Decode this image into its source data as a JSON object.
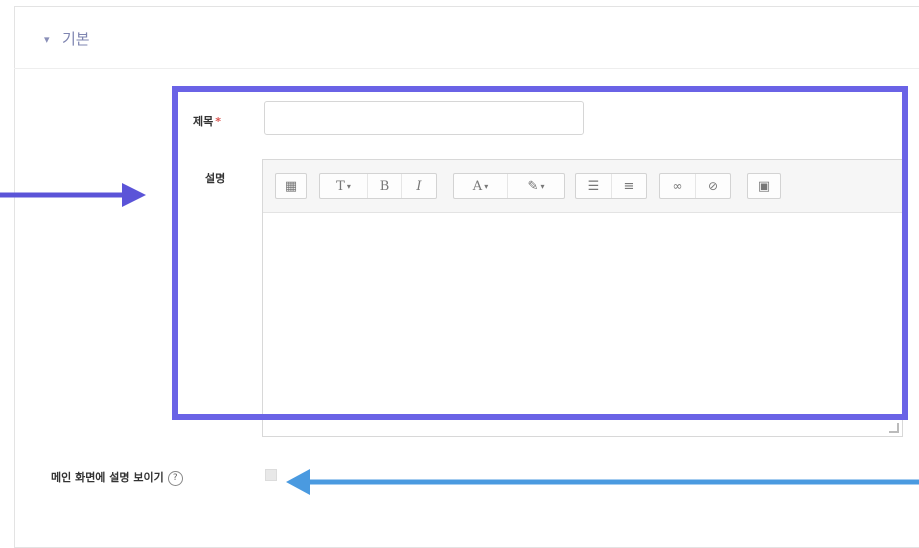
{
  "section": {
    "toggle_icon": "caret-down-icon",
    "title": "기본"
  },
  "form": {
    "title_label": "제목",
    "required_mark": "*",
    "title_value": "",
    "description_label": "설명",
    "editor_toolbar": [
      {
        "group": "toggle",
        "buttons": [
          {
            "icon": "show-more-icon",
            "glyph": "▦"
          }
        ]
      },
      {
        "group": "style",
        "buttons": [
          {
            "icon": "paragraph-style-icon",
            "glyph": "T",
            "has_menu": true
          },
          {
            "icon": "bold-icon",
            "glyph": "B"
          },
          {
            "icon": "italic-icon",
            "glyph": "I"
          }
        ]
      },
      {
        "group": "color",
        "buttons": [
          {
            "icon": "text-color-icon",
            "glyph": "A",
            "has_menu": true
          },
          {
            "icon": "highlight-color-icon",
            "glyph": "✎",
            "has_menu": true
          }
        ]
      },
      {
        "group": "lists",
        "buttons": [
          {
            "icon": "unordered-list-icon",
            "glyph": "☰"
          },
          {
            "icon": "ordered-list-icon",
            "glyph": "≡"
          }
        ]
      },
      {
        "group": "links",
        "buttons": [
          {
            "icon": "link-icon",
            "glyph": "🔗"
          },
          {
            "icon": "unlink-icon",
            "glyph": "⛓"
          }
        ]
      },
      {
        "group": "media",
        "buttons": [
          {
            "icon": "image-icon",
            "glyph": "▣"
          }
        ]
      }
    ],
    "description_value": "",
    "show_description_label": "메인 화면에 설명 보이기",
    "help_glyph": "?",
    "show_description_checked": false
  },
  "colors": {
    "highlight_box": "#6a63e6",
    "left_arrow": "#5b54d8",
    "bottom_arrow": "#4a9ae0"
  }
}
